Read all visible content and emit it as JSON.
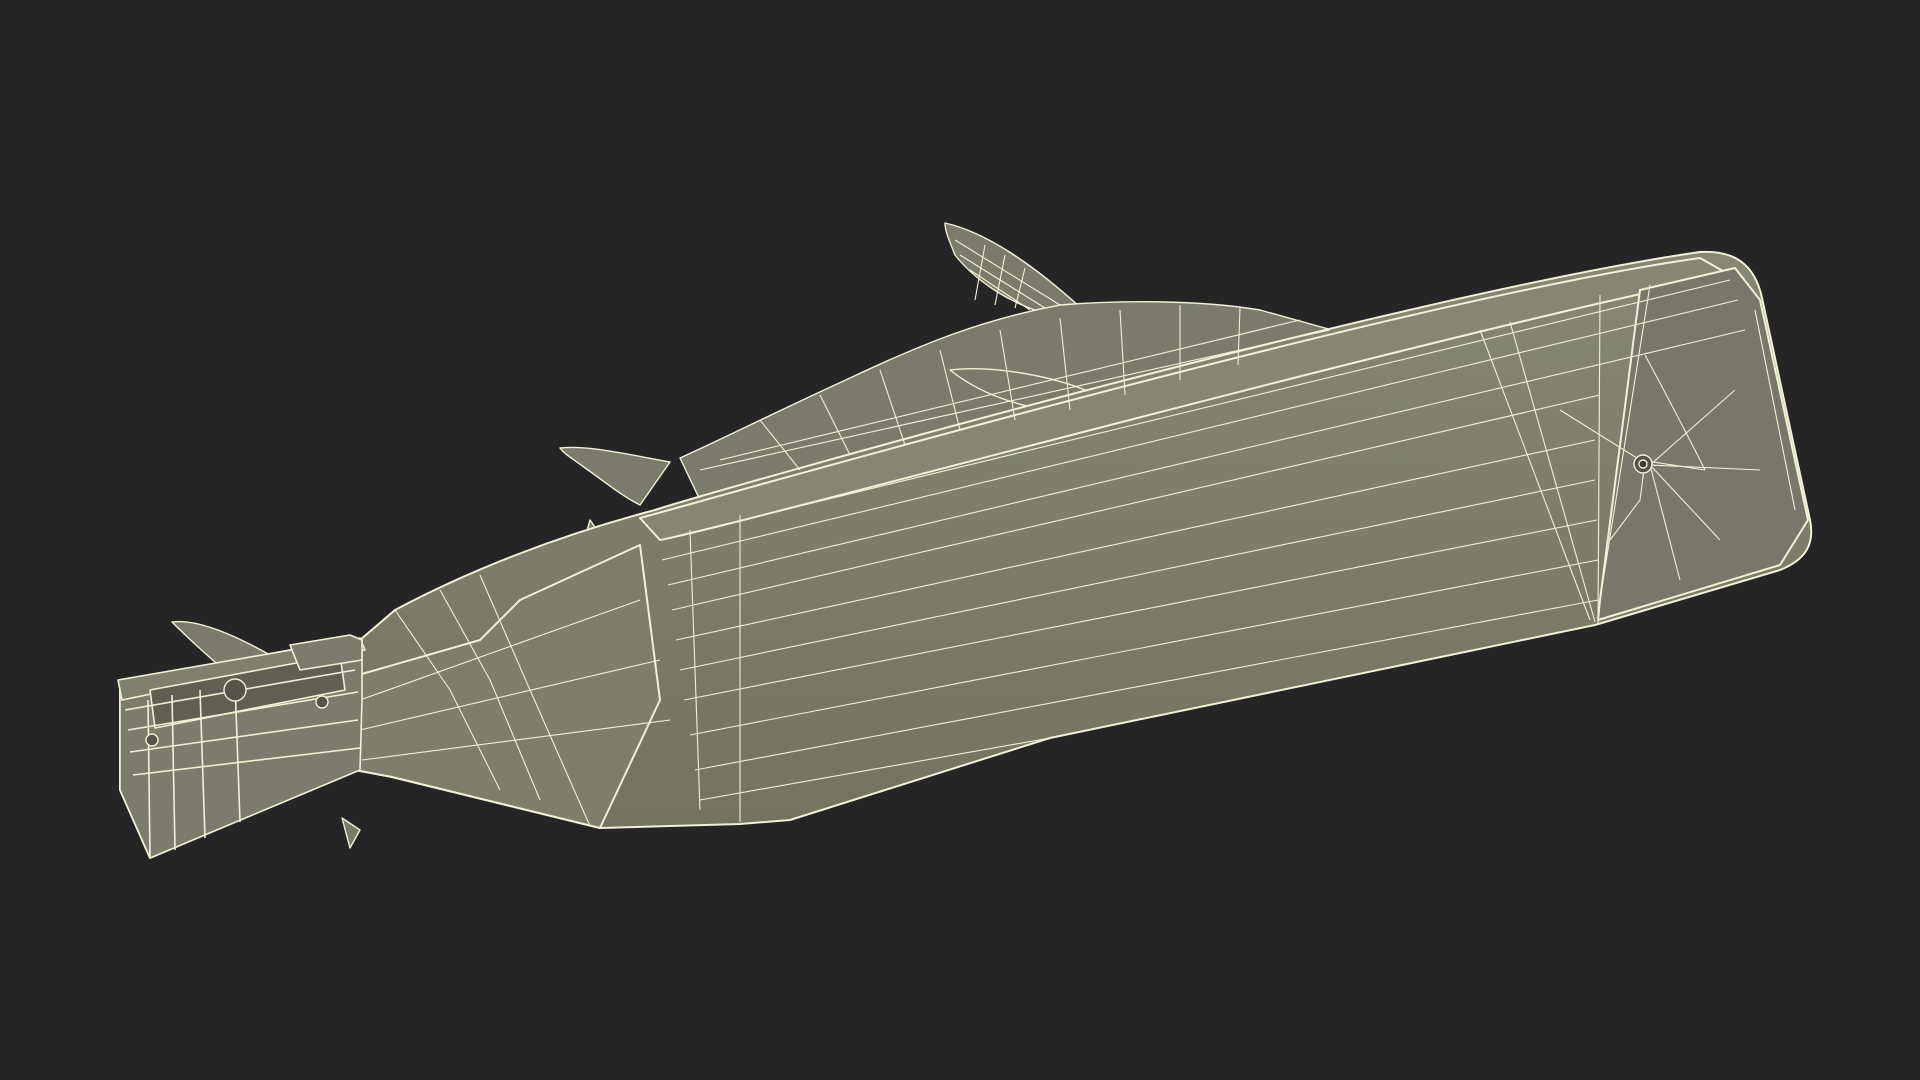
{
  "scene": {
    "subject": "shark-shaped-bottle-opener-wireframe",
    "background_color": "#252525",
    "mesh_fill_color": "#7a7b6a",
    "mesh_fill_dark_color": "#6f705f",
    "wire_color": "#f2f0d6",
    "view": "3d-wireframe-render"
  }
}
